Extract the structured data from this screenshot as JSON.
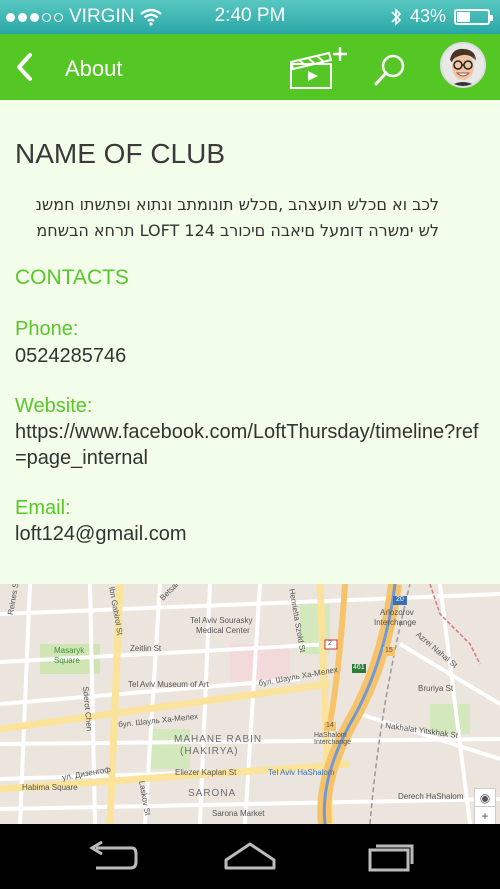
{
  "status_bar": {
    "carrier": "VIRGIN",
    "time": "2:40 PM",
    "battery": "43%",
    "battery_level": 0.43,
    "signal_dots_filled": 3,
    "signal_dots_total": 5,
    "icons": [
      "signal-dots-icon",
      "wifi-icon",
      "bluetooth-icon",
      "battery-icon"
    ]
  },
  "app_bar": {
    "title": "About",
    "color": "#55c724",
    "icons": [
      "back-chevron-icon",
      "add-video-clapper-icon",
      "search-icon",
      "avatar"
    ]
  },
  "club": {
    "name": "NAME OF CLUB",
    "description_line1": "לכב וא םכלש תועצהב ,םכלש תונומתב ונתוא ופתשתו חמשנ",
    "description_line2": "לש ימשרה דומעל םיאבה םיכורב LOFT 124 תרחא הבשחמ"
  },
  "contacts": {
    "title": "CONTACTS",
    "phone_label": "Phone:",
    "phone_value": "0524285746",
    "website_label": "Website:",
    "website_value": "https://www.facebook.com/LoftThursday/timeline?ref=page_internal",
    "email_label": "Email:",
    "email_value": "loft124@gmail.com"
  },
  "map": {
    "labels": {
      "reines": "Reines St",
      "ibn_gabirol": "Ibn Gabirol St",
      "betsalel": "Betsal'el...",
      "tel_aviv_sourasky": "Tel Aviv Sourasky",
      "medical_center": "Medical Center",
      "henrietta": "Henrietta Szold St",
      "arlozorov": "Arlozorov",
      "interchange": "Interchange",
      "masaryk": "Masaryk",
      "square": "Square",
      "zeitlin": "Zeitlin St",
      "museum": "Tel Aviv Museum of Art",
      "shaul": "бул. Шауль Ха-Мелех",
      "shaul2": "бул. Шауль Ха-Мелех",
      "mahane_rabin": "MAHANE RABIN",
      "hakirya": "(HAKIRYA)",
      "hashalom_interchange": "HaShalom Interchange",
      "nakhalat": "Nakhalat Yitskhak St",
      "eliezer": "Eliezer Kaplan St",
      "tel_aviv_hashalom": "Tel Aviv HaShalom",
      "habima": "Habima Square",
      "sarona": "SARONA",
      "sarona_market": "Sarona Market",
      "derech": "Derech HaShalom",
      "bruriya": "Bruriya St",
      "dizengoff": "ул. Дизенгоф",
      "sderot_chen": "Sderot Chen",
      "laskov": "Laskov St",
      "azrei": "Azrei Nahal St",
      "route_2": "2",
      "route_20": "20",
      "route_461": "461",
      "route_15": "15",
      "route_14": "14"
    }
  },
  "nav_bar": {
    "icons": [
      "back-nav-icon",
      "home-nav-icon",
      "recent-apps-nav-icon"
    ]
  }
}
